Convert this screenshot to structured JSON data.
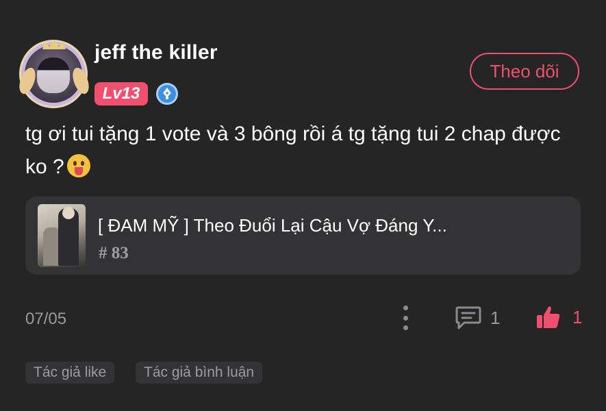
{
  "comment": {
    "username": "jeff the killer",
    "level": "Lv13",
    "follow_label": "Theo dõi",
    "text": "tg ơi tui tặng 1 vote và 3 bông rồi á tg tặng tui 2 chap được ko ?",
    "emoji": "face-with-tongue-emoji",
    "date": "07/05",
    "reply_count": "1",
    "like_count": "1",
    "liked": true
  },
  "manga": {
    "title": "[ ĐAM MỸ ] Theo Đuổi Lại Cậu Vợ Đáng Y...",
    "chapter": "# 83"
  },
  "tags": [
    "Tác giả like",
    "Tác giả bình luận"
  ],
  "colors": {
    "background": "#252526",
    "card": "#333335",
    "accent": "#f0506e",
    "muted_text": "#9a9aa0",
    "vip_badge": "#3d8fe0"
  },
  "icons": {
    "vip": "quill-pen-icon",
    "more": "vertical-dots-icon",
    "reply": "comment-bubble-icon",
    "like": "thumbs-up-icon"
  }
}
